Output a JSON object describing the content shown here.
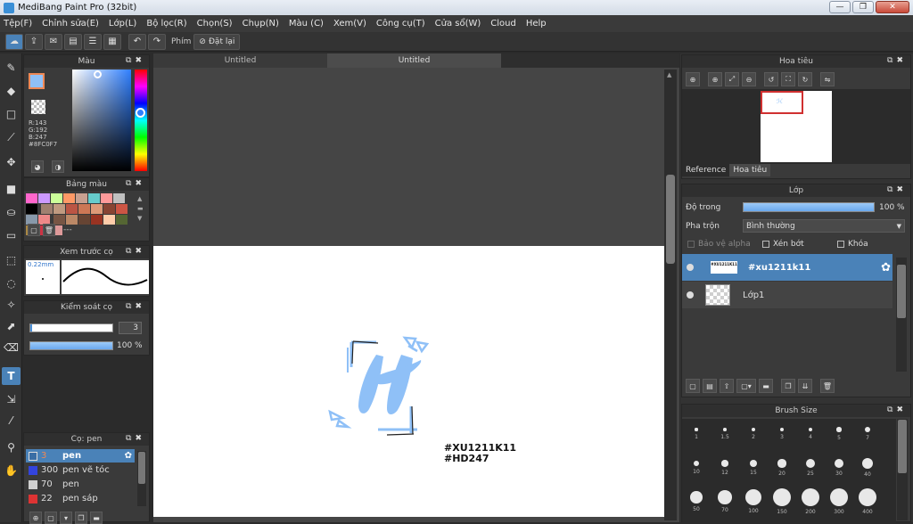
{
  "window": {
    "title": "MediBang Paint Pro (32bit)",
    "minimize": "—",
    "restore": "❐",
    "close": "✕"
  },
  "menu": [
    "Tệp(F)",
    "Chỉnh sửa(E)",
    "Lớp(L)",
    "Bộ lọc(R)",
    "Chọn(S)",
    "Chụp(N)",
    "Màu (C)",
    "Xem(V)",
    "Công cụ(T)",
    "Cửa sổ(W)",
    "Cloud",
    "Help"
  ],
  "toolbar": {
    "shortcut_label": "Phím",
    "reset_label": "Đặt lại"
  },
  "tabs": [
    "Untitled",
    "Untitled"
  ],
  "color_panel": {
    "title": "Màu",
    "r": "R:143",
    "g": "G:192",
    "b": "B:247",
    "hex": "#8FC0F7",
    "current_color": "#8FC0F7"
  },
  "palette_panel": {
    "title": "Bảng màu",
    "value": "---"
  },
  "brush_preview": {
    "title": "Xem trước cọ",
    "size": "0.22mm"
  },
  "brush_control": {
    "title": "Kiểm soát cọ",
    "size": "3",
    "opacity": "100 %"
  },
  "brush_list": {
    "title": "Cọ: pen",
    "items": [
      {
        "size": "3",
        "name": "pen",
        "color": "#3a6ea5"
      },
      {
        "size": "300",
        "name": "pen vẽ tóc",
        "color": "#3344dd"
      },
      {
        "size": "70",
        "name": "pen",
        "color": "#d0d0d0"
      },
      {
        "size": "22",
        "name": "pen sáp",
        "color": "#dd3333"
      }
    ]
  },
  "navigator": {
    "title": "Hoa tiêu",
    "tabs": [
      "Reference",
      "Hoa tiêu"
    ]
  },
  "layer_panel": {
    "title": "Lớp",
    "opacity_label": "Độ trong",
    "opacity_value": "100 %",
    "blend_label": "Pha trộn",
    "blend_value": "Bình thường",
    "protect_alpha": "Bảo vệ alpha",
    "clipping": "Xén bớt",
    "lock": "Khóa",
    "layers": [
      {
        "name": "#xu1211k11",
        "thumb_text": "#XU1211K11"
      },
      {
        "name": "Lớp1"
      }
    ]
  },
  "brush_size": {
    "title": "Brush Size",
    "sizes": [
      "1",
      "1.5",
      "2",
      "3",
      "4",
      "5",
      "7",
      "10",
      "12",
      "15",
      "20",
      "25",
      "30",
      "40",
      "50",
      "70",
      "100",
      "150",
      "200",
      "300",
      "400"
    ]
  },
  "artwork": {
    "letter": "H",
    "line1": "#XU1211K11",
    "line2": "#HD247",
    "accent": "#8FC0F7"
  }
}
